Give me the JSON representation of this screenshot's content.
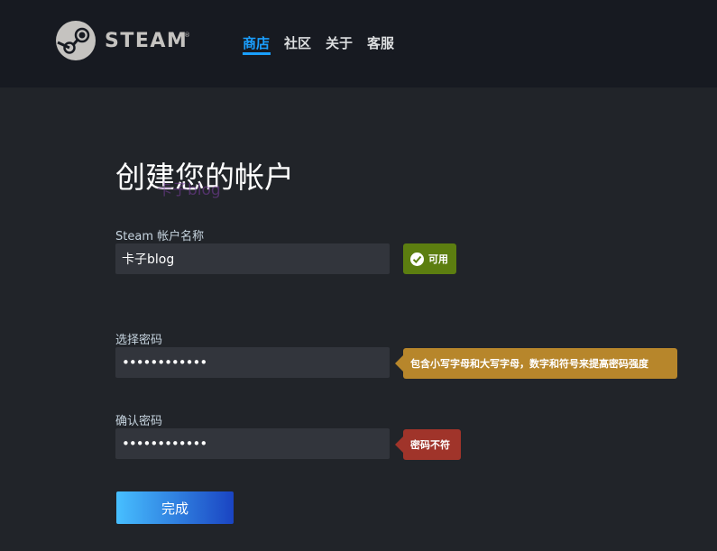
{
  "header": {
    "logo_text": "STEAM",
    "logo_reg": "®",
    "nav": [
      {
        "label": "商店",
        "active": true
      },
      {
        "label": "社区",
        "active": false
      },
      {
        "label": "关于",
        "active": false
      },
      {
        "label": "客服",
        "active": false
      }
    ]
  },
  "form": {
    "title": "创建您的帐户",
    "watermark": "卡子blog",
    "account": {
      "label": "Steam 帐户名称",
      "value": "卡子blog",
      "status": "可用"
    },
    "password": {
      "label": "选择密码",
      "value": "••••••••••••",
      "hint": "包含小写字母和大写字母，数字和符号来提高密码强度"
    },
    "confirm": {
      "label": "确认密码",
      "value": "••••••••••••",
      "error": "密码不符"
    },
    "submit_label": "完成"
  },
  "colors": {
    "accent": "#1a9fff",
    "ok": "#5c7e10",
    "warn": "#b7862b",
    "error": "#a0342a",
    "header_bg": "#171a21",
    "page_bg": "#212429"
  }
}
